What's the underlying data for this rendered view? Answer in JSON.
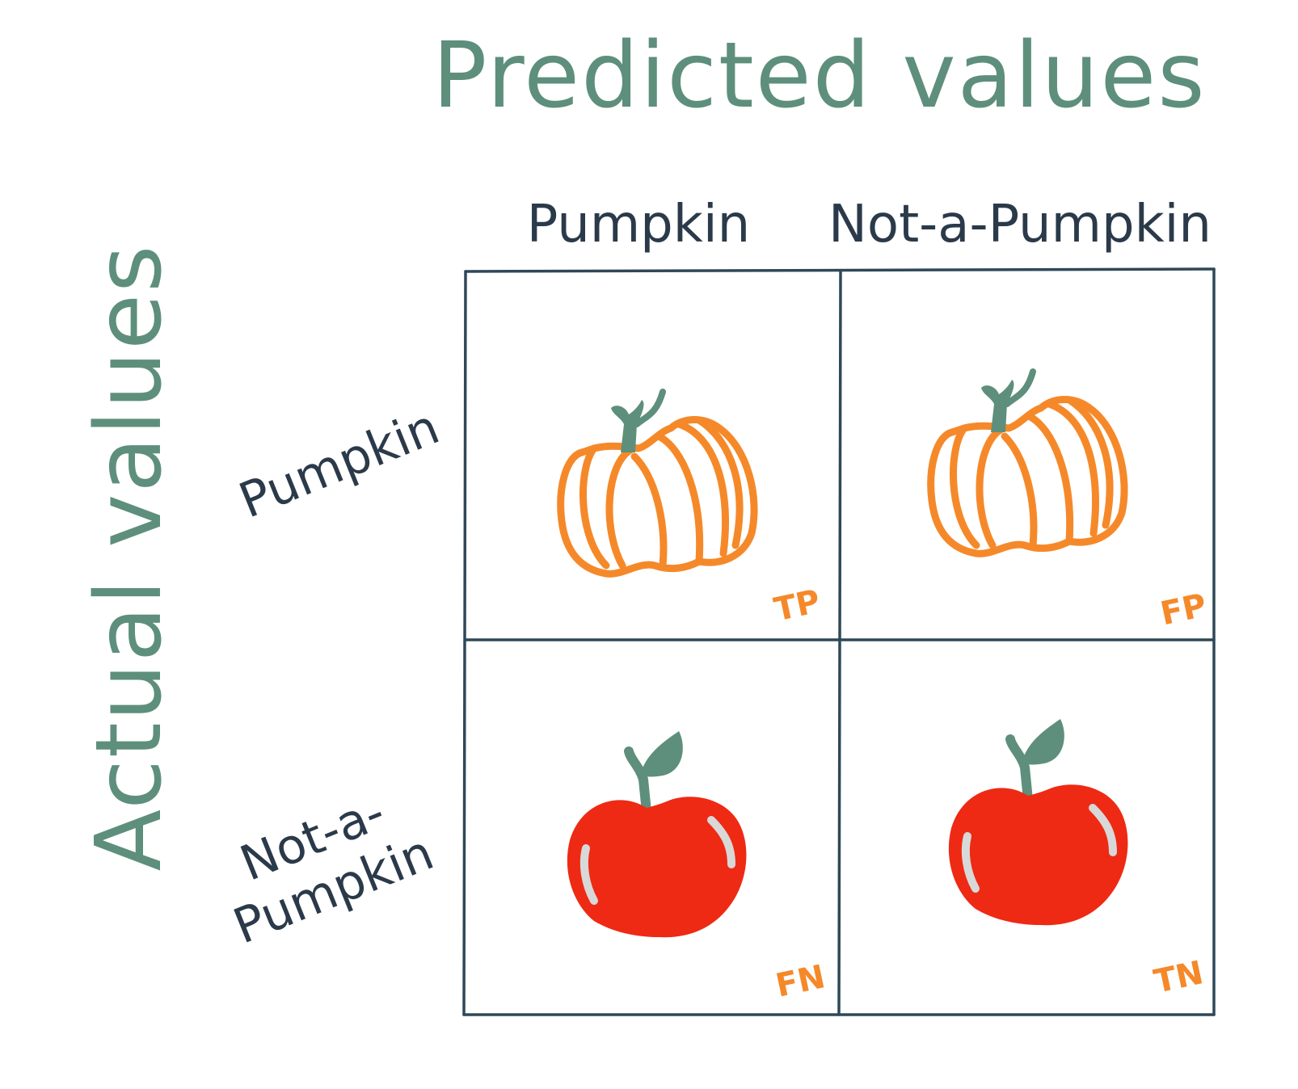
{
  "colors": {
    "title": "#5e8f7c",
    "label": "#2b3a4a",
    "grid": "#2f4858",
    "pumpkin": "#f5892a",
    "stem": "#5e8f7c",
    "apple": "#ee2a14",
    "apple_highlight": "#d8d8d8",
    "tag": "#f5892a"
  },
  "title_top": "Predicted values",
  "title_side": "Actual values",
  "columns": [
    "Pumpkin",
    "Not-a-Pumpkin"
  ],
  "rows": [
    {
      "lines": [
        "Pumpkin"
      ]
    },
    {
      "lines": [
        "Not-a-",
        "Pumpkin"
      ]
    }
  ],
  "cells": [
    {
      "tag": "TP",
      "icon": "pumpkin-icon"
    },
    {
      "tag": "FP",
      "icon": "pumpkin-icon"
    },
    {
      "tag": "FN",
      "icon": "apple-icon"
    },
    {
      "tag": "TN",
      "icon": "apple-icon"
    }
  ]
}
